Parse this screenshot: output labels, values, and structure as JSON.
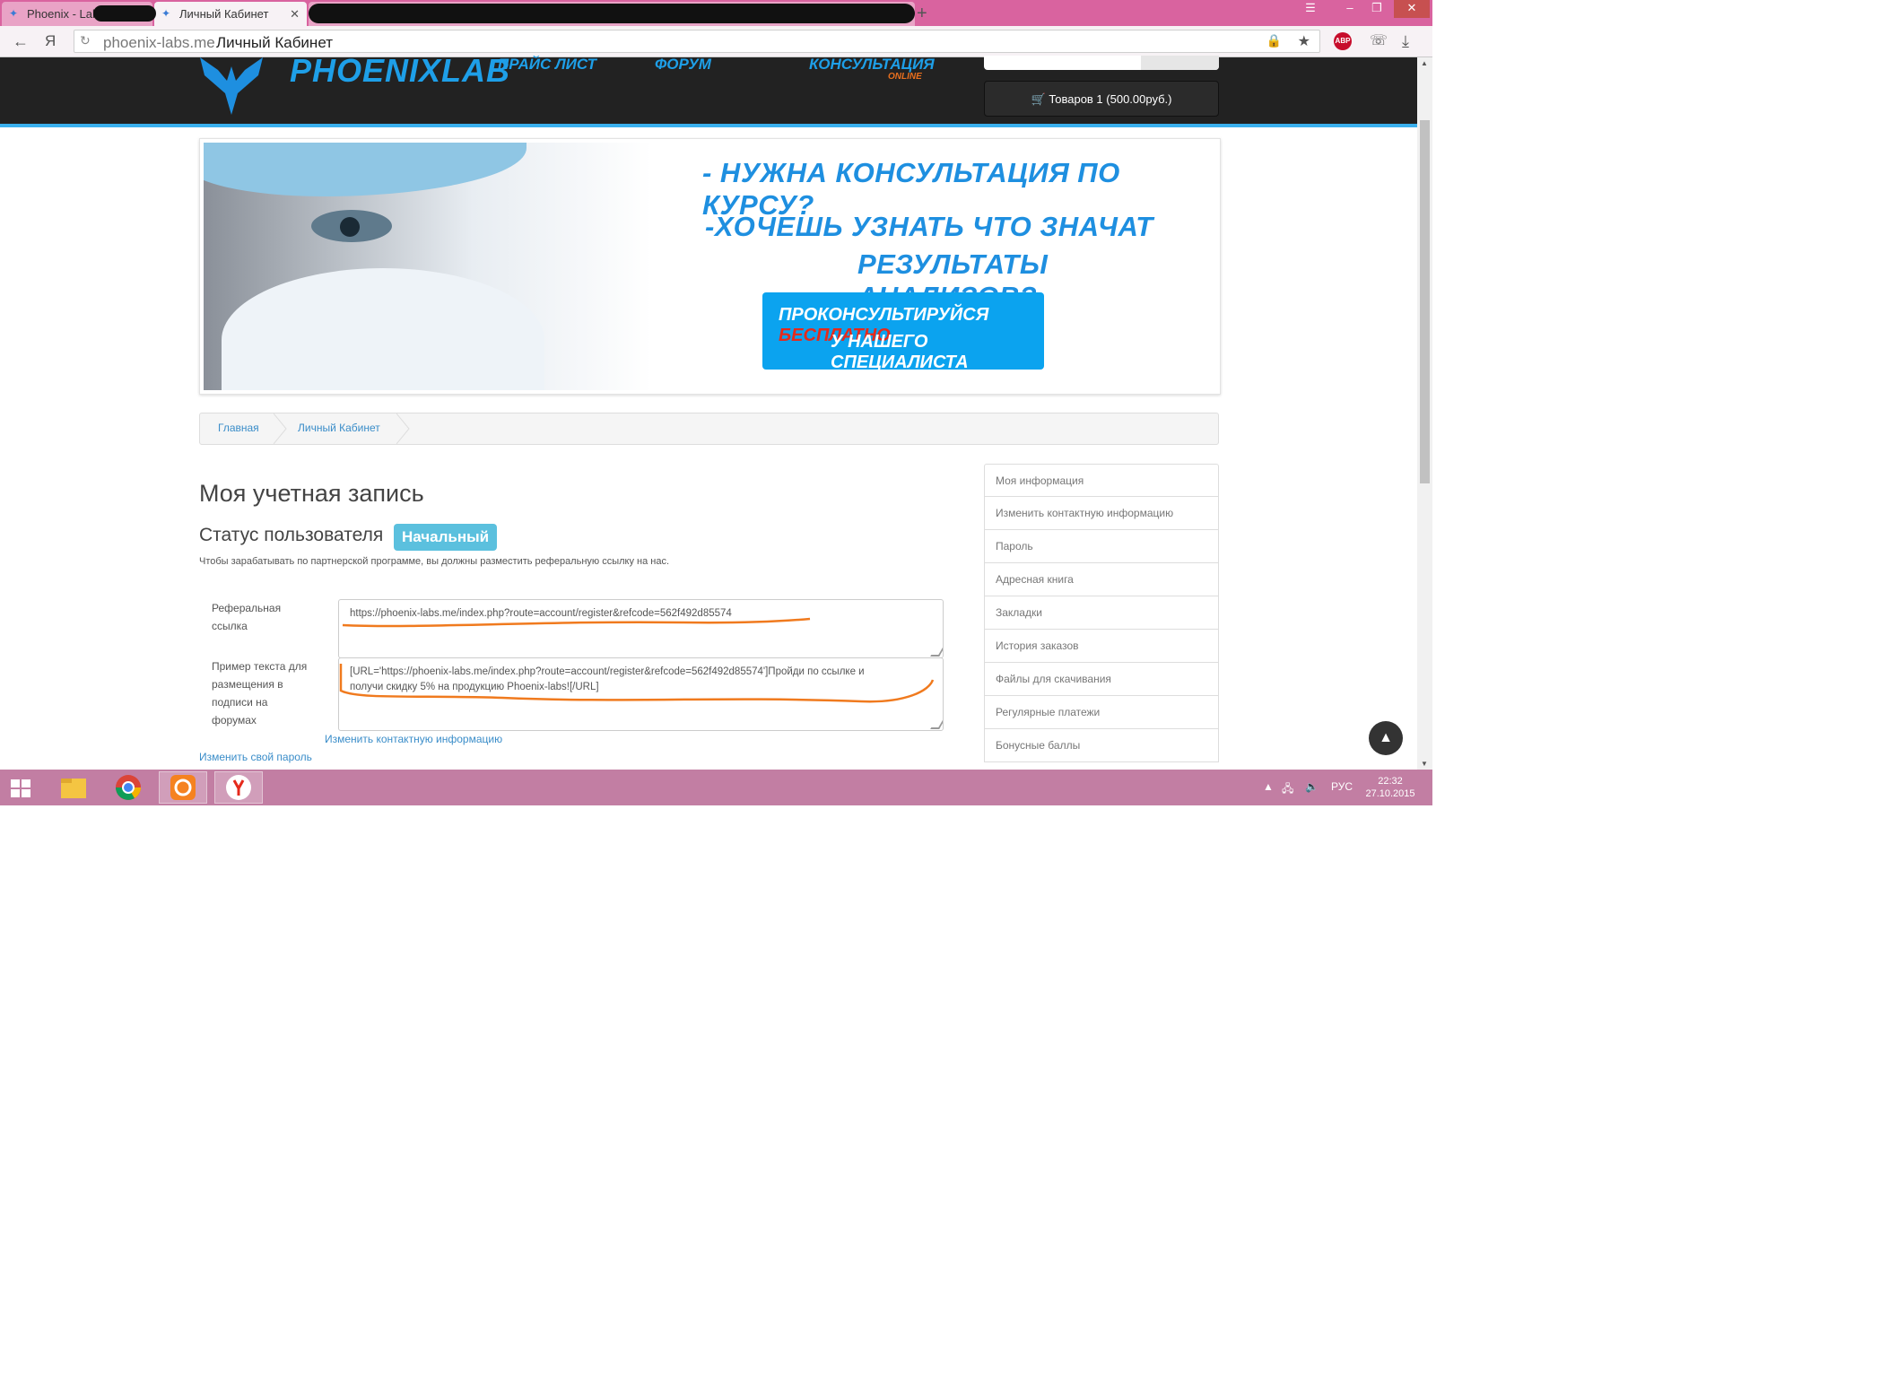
{
  "browser": {
    "tabs": [
      {
        "label": "Phoenix - Labs"
      },
      {
        "label": "Личный Кабинет"
      }
    ],
    "url_domain": "phoenix-labs.me",
    "url_title": "Личный Кабинет",
    "extension_abp": "ABP"
  },
  "header": {
    "logo_text": "PHOENIXLAB",
    "nav": [
      {
        "label": "ПРАЙС ЛИСТ"
      },
      {
        "label": "ФОРУМ"
      },
      {
        "label": "КОНСУЛЬТАЦИЯ"
      }
    ],
    "nav_online": "ONLINE",
    "cart_label": "Товаров 1 (500.00руб.)"
  },
  "banner": {
    "line1": "- НУЖНА КОНСУЛЬТАЦИЯ ПО КУРСУ?",
    "line2": "-ХОЧЕШЬ УЗНАТЬ ЧТО ЗНАЧАТ",
    "line3": "РЕЗУЛЬТАТЫ АНАЛИЗОВ?",
    "cta_part1": "ПРОКОНСУЛЬТИРУЙСЯ",
    "cta_part1_highlight": "БЕСПЛАТНО",
    "cta_part2": "У НАШЕГО СПЕЦИАЛИСТА"
  },
  "breadcrumb": [
    {
      "label": "Главная"
    },
    {
      "label": "Личный Кабинет"
    }
  ],
  "account": {
    "title": "Моя учетная запись",
    "status_label": "Статус пользователя",
    "status_badge": "Начальный",
    "hint": "Чтобы зарабатывать по партнерской программе, вы должны разместить реферальную ссылку на нас.",
    "ref_label_1": "Реферальная",
    "ref_label_2": "ссылка",
    "ref_value": "https://phoenix-labs.me/index.php?route=account/register&refcode=562f492d85574",
    "sample_label_1": "Пример текста для",
    "sample_label_2": "размещения в",
    "sample_label_3": "подписи на",
    "sample_label_4": "форумах",
    "sample_value_1": "[URL='https://phoenix-labs.me/index.php?route=account/register&refcode=562f492d85574']Пройди по ссылке и",
    "sample_value_2": "получи скидку 5% на продукцию Phoenix-labs![/URL]",
    "edit_contact_link": "Изменить контактную информацию",
    "change_password_link": "Изменить свой пароль"
  },
  "sidebar": {
    "items": [
      {
        "label": "Моя информация"
      },
      {
        "label": "Изменить контактную информацию"
      },
      {
        "label": "Пароль"
      },
      {
        "label": "Адресная книга"
      },
      {
        "label": "Закладки"
      },
      {
        "label": "История заказов"
      },
      {
        "label": "Файлы для скачивания"
      },
      {
        "label": "Регулярные платежи"
      },
      {
        "label": "Бонусные баллы"
      }
    ]
  },
  "taskbar": {
    "language": "РУС",
    "time": "22:32",
    "date": "27.10.2015"
  },
  "colors": {
    "accent": "#1e9fe8",
    "badge": "#5bc0de",
    "annotation": "#f07a1e",
    "taskbar": "#c27ea3",
    "tabstrip": "#d9639f"
  }
}
